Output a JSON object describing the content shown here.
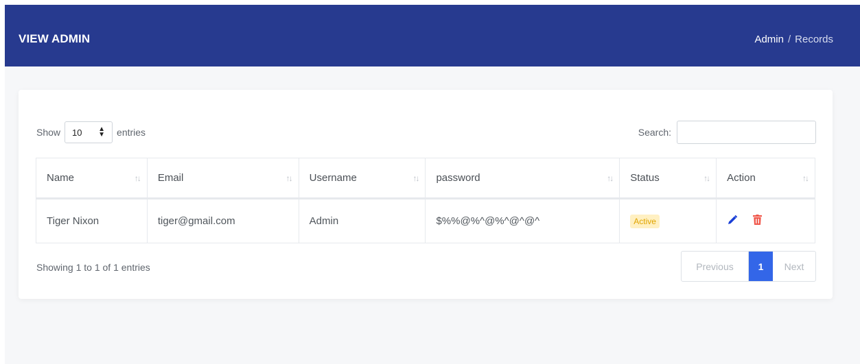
{
  "header": {
    "title": "VIEW ADMIN",
    "breadcrumb": {
      "parent": "Admin",
      "separator": "/",
      "current": "Records"
    }
  },
  "table_controls": {
    "show_label": "Show",
    "page_size": "10",
    "entries_label": "entries",
    "search_label": "Search:",
    "search_value": ""
  },
  "table": {
    "columns": [
      "Name",
      "Email",
      "Username",
      "password",
      "Status",
      "Action"
    ],
    "rows": [
      {
        "name": "Tiger Nixon",
        "email": "tiger@gmail.com",
        "username": "Admin",
        "password": "$%%@%^@%^@^@^",
        "status": "Active"
      }
    ]
  },
  "footer": {
    "info": "Showing 1 to 1 of 1 entries",
    "pagination": {
      "previous": "Previous",
      "current": "1",
      "next": "Next"
    }
  },
  "colors": {
    "header_bg": "#273a8f",
    "accent": "#3366e8",
    "edit_icon": "#1a3fd6",
    "delete_icon": "#f0564a",
    "status_active": "#e0a400"
  },
  "icons": {
    "edit": "pencil-icon",
    "delete": "trash-icon",
    "sort": "sort-arrows-icon",
    "select_arrow": "select-arrows-icon"
  }
}
